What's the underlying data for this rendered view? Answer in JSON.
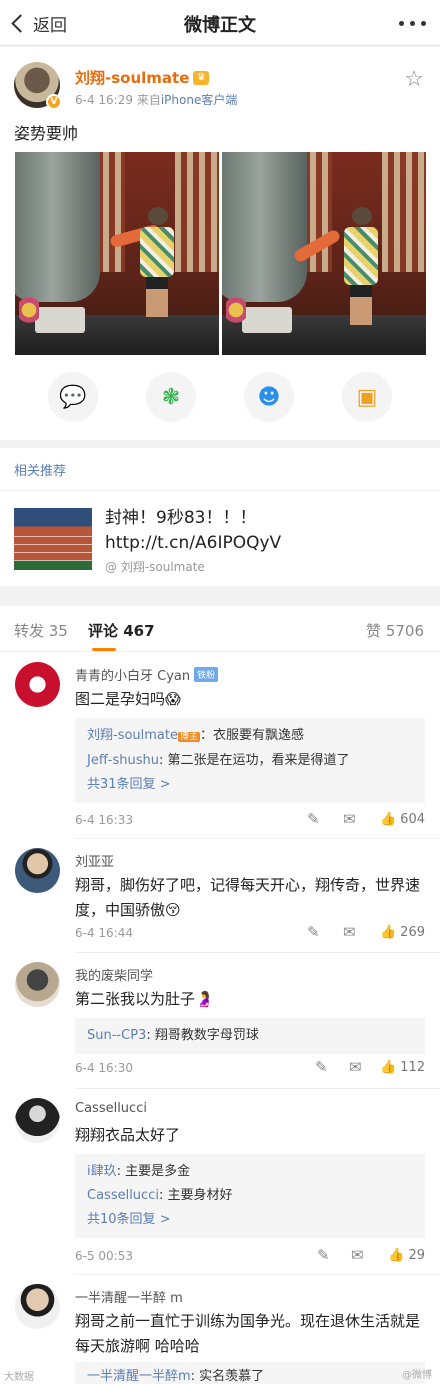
{
  "nav": {
    "back": "返回",
    "title": "微博正文"
  },
  "post": {
    "author": "刘翔-soulmate",
    "date": "6-4 16:29",
    "from": "来自",
    "source": "iPhone客户端",
    "text": "姿势要帅"
  },
  "share": [
    "wechat-icon",
    "moments-icon",
    "qq-icon",
    "save-image-icon"
  ],
  "related": {
    "heading": "相关推荐",
    "title": "封神！9秒83！！！ http://t.cn/A6IPOQyV",
    "by": "@ 刘翔-soulmate"
  },
  "tabs": {
    "repost": "转发 35",
    "comment": "评论 467",
    "like": "赞 5706"
  },
  "comments": [
    {
      "name": "青青的小白牙 Cyan",
      "tag": "铁粉",
      "text": "图二是孕妇吗😱",
      "replies": [
        {
          "name": "刘翔-soulmate",
          "badge": "博主",
          "text": "：衣服要有飘逸感"
        },
        {
          "name": "Jeff-shushu",
          "text": ": 第二张是在运功，看来是得道了"
        }
      ],
      "more": "共31条回复 >",
      "time": "6-4 16:33",
      "likes": "604"
    },
    {
      "name": "刘亚亚",
      "text": "翔哥，脚伤好了吧，记得每天开心，翔传奇，世界速度，中国骄傲😚",
      "time": "6-4 16:44",
      "likes": "269"
    },
    {
      "name": "我的废柴同学",
      "text": "第二张我以为肚子🤰",
      "replies": [
        {
          "name": "Sun--CP3",
          "text": ": 翔哥教数字母罚球"
        }
      ],
      "time": "6-4 16:30",
      "likes": "112"
    },
    {
      "name": "Cassellucci",
      "text": "翔翔衣品太好了",
      "replies": [
        {
          "name": "i肆玖",
          "text": ": 主要是多金"
        },
        {
          "name": "Cassellucci",
          "text": ": 主要身材好"
        }
      ],
      "more": "共10条回复 >",
      "time": "6-5 00:53",
      "likes": "29"
    },
    {
      "name": "一半清醒一半醉 m",
      "text": "翔哥之前一直忙于训练为国争光。现在退休生活就是每天旅游啊 哈哈哈",
      "replies": [
        {
          "name": "一半清醒一半醉m",
          "text": ": 实名羡慕了"
        }
      ]
    }
  ],
  "watermarks": {
    "left": "大数据",
    "right": "@微博"
  }
}
